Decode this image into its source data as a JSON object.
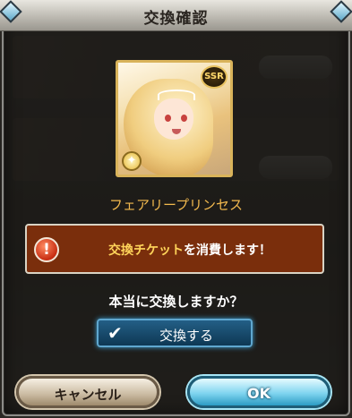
{
  "dialog": {
    "title": "交換確認",
    "item_name": "フェアリープリンセス",
    "rarity_badge": "SSR",
    "notice": {
      "highlight": "交換チケット",
      "rest": "を消費します！"
    },
    "question": "本当に交換しますか？",
    "exchange_button": "交換する",
    "cancel_button": "キャンセル",
    "ok_button": "OK"
  },
  "icons": {
    "warning": "warning-icon",
    "check": "check-icon",
    "element": "light-element-icon"
  },
  "colors": {
    "name_gold": "#f2b94e",
    "notice_bg": "#7a2e0c",
    "highlight": "#ffd45a",
    "exchange_blue": "#235f86"
  }
}
